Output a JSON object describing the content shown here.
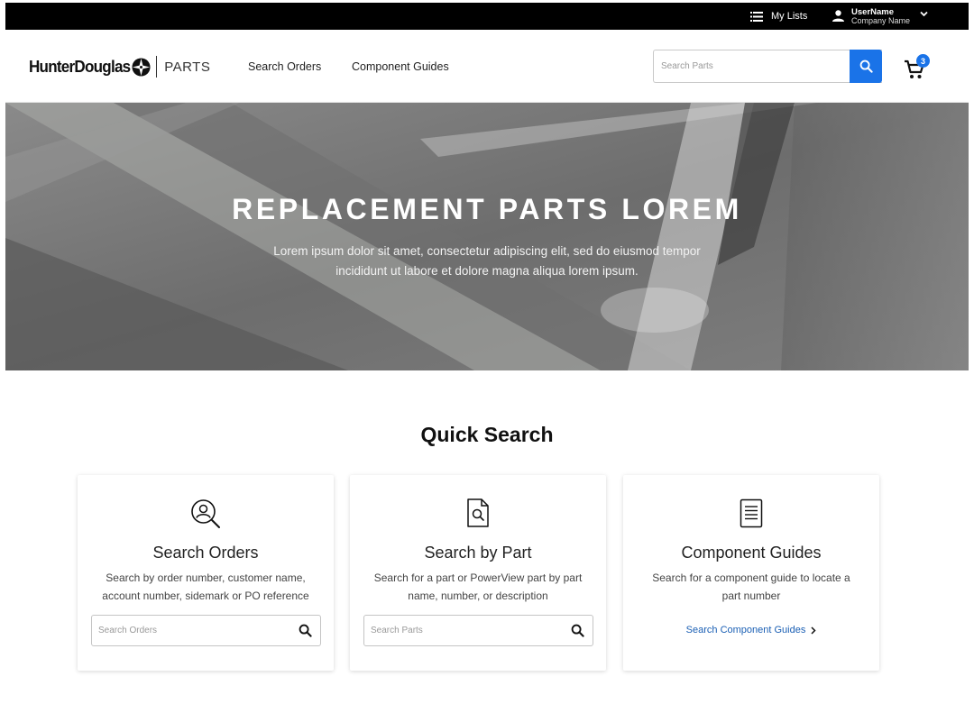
{
  "topbar": {
    "my_lists": "My Lists",
    "username": "UserName",
    "company": "Company Name"
  },
  "header": {
    "brand": "HunterDouglas",
    "section": "PARTS",
    "nav": [
      "Search Orders",
      "Component Guides"
    ],
    "search_placeholder": "Search Parts",
    "cart_count": "3"
  },
  "hero": {
    "title": "REPLACEMENT PARTS LOREM",
    "subtitle": "Lorem ipsum dolor sit amet, consectetur adipiscing elit, sed do eiusmod tempor incididunt ut labore et dolore magna aliqua lorem ipsum."
  },
  "quick_search": {
    "title": "Quick Search",
    "cards": [
      {
        "title": "Search Orders",
        "description": "Search by order number, customer name, account number, sidemark or PO reference",
        "placeholder": "Search Orders"
      },
      {
        "title": "Search by Part",
        "description": "Search for a part or PowerView part by part name, number, or description",
        "placeholder": "Search Parts"
      },
      {
        "title": "Component Guides",
        "description": "Search for a component guide to locate a part number",
        "link": "Search Component Guides"
      }
    ]
  },
  "colors": {
    "accent": "#1a73e8",
    "link": "#1a5fb4",
    "topbar": "#000000"
  },
  "icons": {
    "list": "list-icon",
    "user": "person-icon",
    "search": "search-icon",
    "cart": "cart-icon",
    "chevron": "chevron-right-icon"
  }
}
